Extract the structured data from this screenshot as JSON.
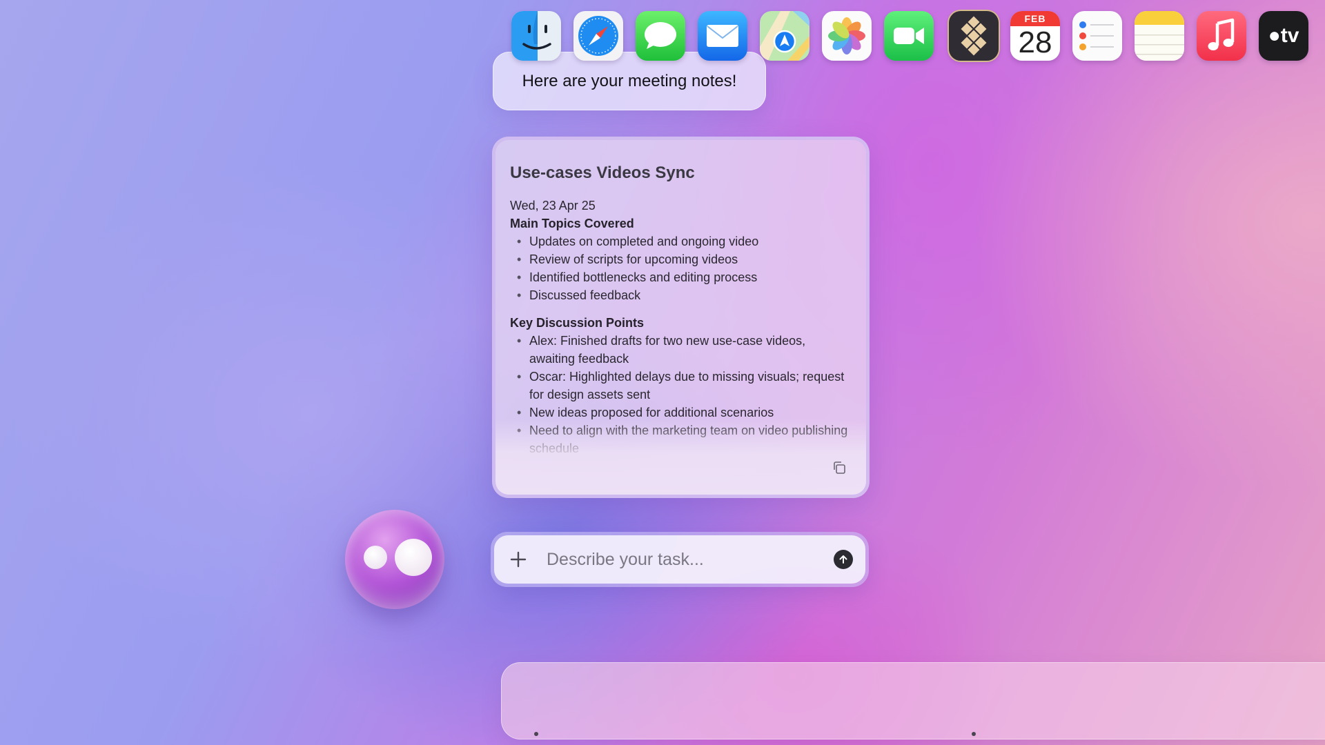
{
  "greeting": {
    "message": "Here are your meeting notes!"
  },
  "notes": {
    "title": "Use-cases Videos Sync",
    "date": "Wed, 23 Apr 25",
    "sections": [
      {
        "heading": "Main Topics Covered",
        "items": [
          "Updates on completed and ongoing video",
          "Review of scripts for upcoming videos",
          "Identified bottlenecks and editing process",
          "Discussed feedback"
        ]
      },
      {
        "heading": "Key Discussion Points",
        "items": [
          "Alex: Finished drafts for two new use-case videos, awaiting feedback",
          "Oscar: Highlighted delays due to missing visuals; request for design assets sent",
          "New ideas proposed for additional scenarios",
          "Need to align with the marketing team on video publishing schedule"
        ]
      }
    ],
    "copy_icon": "copy-icon"
  },
  "assistant": {
    "avatar_icon": "assistant-orb-icon"
  },
  "task_input": {
    "placeholder": "Describe your task...",
    "add_icon": "plus-icon",
    "send_icon": "arrow-up-icon"
  },
  "dock": {
    "apps": [
      {
        "name": "Finder",
        "icon": "finder-icon",
        "running": true
      },
      {
        "name": "Safari",
        "icon": "safari-icon",
        "running": false
      },
      {
        "name": "Messages",
        "icon": "messages-icon",
        "running": false
      },
      {
        "name": "Mail",
        "icon": "mail-icon",
        "running": false
      },
      {
        "name": "Maps",
        "icon": "maps-icon",
        "running": false
      },
      {
        "name": "Photos",
        "icon": "photos-icon",
        "running": false
      },
      {
        "name": "FaceTime",
        "icon": "facetime-icon",
        "running": false
      },
      {
        "name": "Assistant",
        "icon": "diamond-grid-icon",
        "running": true
      },
      {
        "name": "Calendar",
        "icon": "calendar-icon",
        "running": false,
        "month": "FEB",
        "day": "28"
      },
      {
        "name": "Reminders",
        "icon": "reminders-icon",
        "running": false
      },
      {
        "name": "Notes",
        "icon": "notes-icon",
        "running": false
      },
      {
        "name": "Music",
        "icon": "music-icon",
        "running": false
      },
      {
        "name": "TV",
        "icon": "tv-icon",
        "running": false,
        "label": "tv"
      }
    ]
  }
}
